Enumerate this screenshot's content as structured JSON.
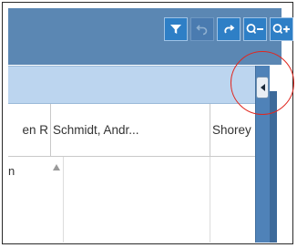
{
  "toolbar": {
    "buttons": [
      {
        "icon": "filter-icon",
        "enabled": true
      },
      {
        "icon": "undo-icon",
        "enabled": false
      },
      {
        "icon": "redo-icon",
        "enabled": true
      },
      {
        "icon": "zoom-out-icon",
        "enabled": true
      },
      {
        "icon": "zoom-in-icon",
        "enabled": true
      }
    ]
  },
  "panel": {
    "collapse_icon": "chevron-left-icon"
  },
  "grid": {
    "columns": [
      {
        "label": "en R"
      },
      {
        "label": "Schmidt, Andr..."
      },
      {
        "label": "Shorey"
      }
    ],
    "row_fragment": "n"
  },
  "colors": {
    "toolbar_bg": "#5b87b3",
    "button_bg": "#2e7fc6",
    "strip_bg": "#bcd5ef",
    "annotation": "#e0271f"
  }
}
